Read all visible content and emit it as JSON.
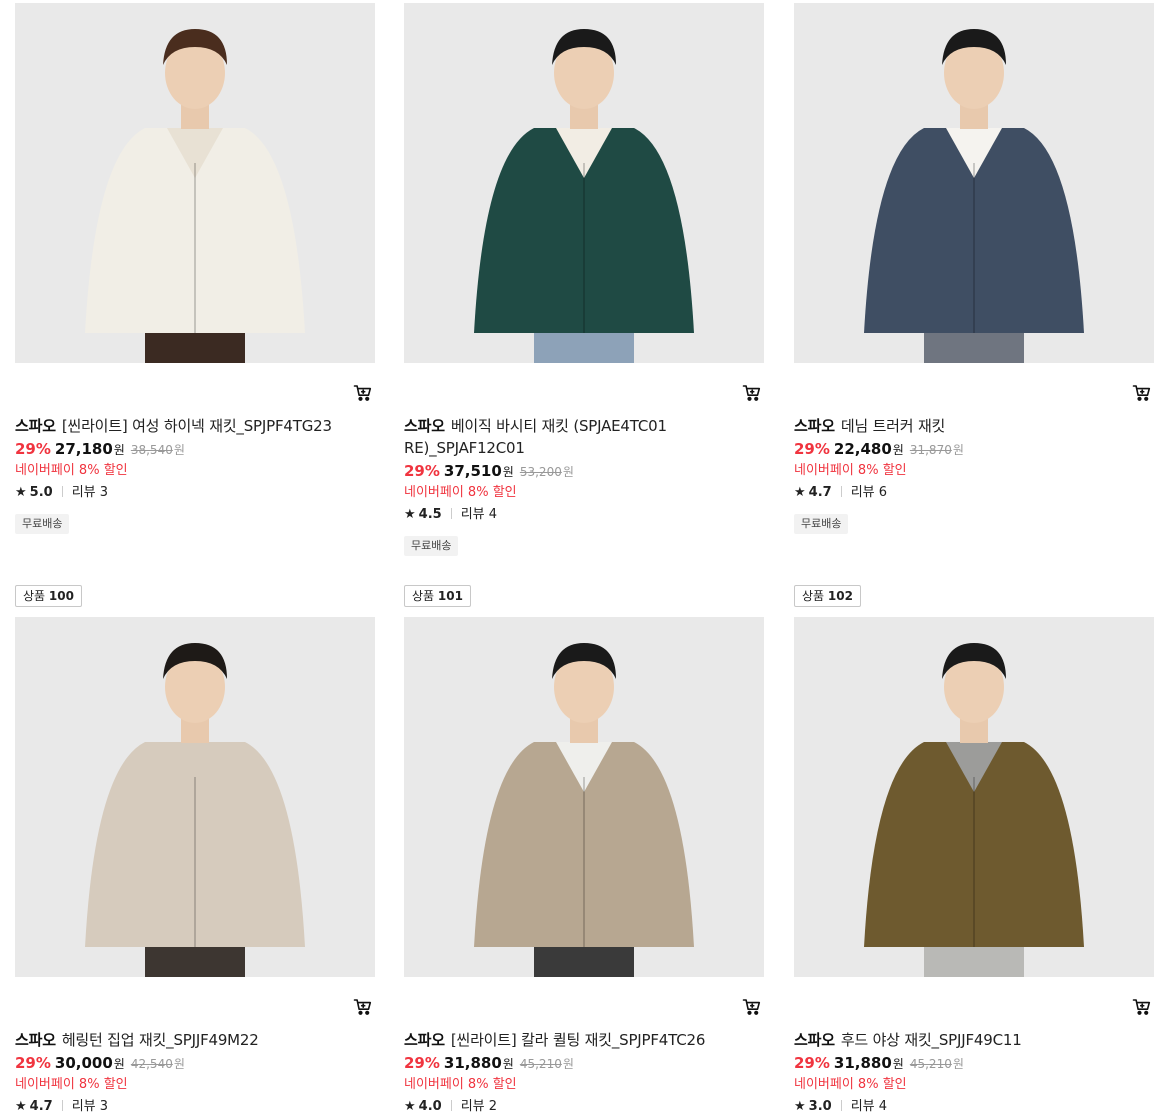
{
  "products": [
    {
      "brand": "스파오",
      "name": "[씬라이트] 여성 하이넥 재킷_SPJPF4TG23",
      "discount": "29%",
      "price": "27,180",
      "currency": "원",
      "original_price": "38,540",
      "npay": "네이버페이 8% 할인",
      "rating": "5.0",
      "reviews": "리뷰 3",
      "shipping": "무료배송",
      "image": {
        "desc": "woman in cream puffer jacket",
        "jacket": "#f1eee6",
        "inner": "#e8e1d4",
        "pants": "#3b2a22",
        "hair": "#4a2d1e"
      }
    },
    {
      "brand": "스파오",
      "name": "베이직 바시티 재킷 (SPJAE4TC01 RE)_SPJAF12C01",
      "discount": "29%",
      "price": "37,510",
      "currency": "원",
      "original_price": "53,200",
      "npay": "네이버페이 8% 할인",
      "rating": "4.5",
      "reviews": "리뷰 4",
      "shipping": "무료배송",
      "image": {
        "desc": "man in green varsity jacket",
        "jacket": "#1f4a44",
        "inner": "#f2ede4",
        "pants": "#8da2b8",
        "hair": "#1a1a1a"
      }
    },
    {
      "brand": "스파오",
      "name": "데님 트러커 재킷",
      "discount": "29%",
      "price": "22,480",
      "currency": "원",
      "original_price": "31,870",
      "npay": "네이버페이 8% 할인",
      "rating": "4.7",
      "reviews": "리뷰 6",
      "shipping": "무료배송",
      "image": {
        "desc": "man in denim trucker jacket",
        "jacket": "#3f4e63",
        "inner": "#f5f3ef",
        "pants": "#6f7580",
        "hair": "#1a1a1a"
      }
    },
    {
      "rank_label": "상품",
      "rank": "100",
      "brand": "스파오",
      "name": "헤링턴 집업 재킷_SPJJF49M22",
      "discount": "29%",
      "price": "30,000",
      "currency": "원",
      "original_price": "42,540",
      "npay": "네이버페이 8% 할인",
      "rating": "4.7",
      "reviews": "리뷰 3",
      "image": {
        "desc": "man in beige harrington jacket",
        "jacket": "#d6cbbd",
        "inner": "#d6cbbd",
        "pants": "#3d3631",
        "hair": "#1e1a17"
      }
    },
    {
      "rank_label": "상품",
      "rank": "101",
      "brand": "스파오",
      "name": "[씬라이트] 칼라 퀼팅 재킷_SPJPF4TC26",
      "discount": "29%",
      "price": "31,880",
      "currency": "원",
      "original_price": "45,210",
      "npay": "네이버페이 8% 할인",
      "rating": "4.0",
      "reviews": "리뷰 2",
      "image": {
        "desc": "man in beige quilted jacket",
        "jacket": "#b7a791",
        "inner": "#efefec",
        "pants": "#3a3a3a",
        "hair": "#1a1a1a"
      }
    },
    {
      "rank_label": "상품",
      "rank": "102",
      "brand": "스파오",
      "name": "후드 야상 재킷_SPJJF49C11",
      "discount": "29%",
      "price": "31,880",
      "currency": "원",
      "original_price": "45,210",
      "npay": "네이버페이 8% 할인",
      "rating": "3.0",
      "reviews": "리뷰 4",
      "image": {
        "desc": "man in olive hooded field jacket",
        "jacket": "#6e5a2f",
        "inner": "#9c9c9a",
        "pants": "#b9b9b6",
        "hair": "#1a1a1a"
      }
    }
  ],
  "icons": {
    "cart": "cart-icon",
    "star": "★"
  }
}
